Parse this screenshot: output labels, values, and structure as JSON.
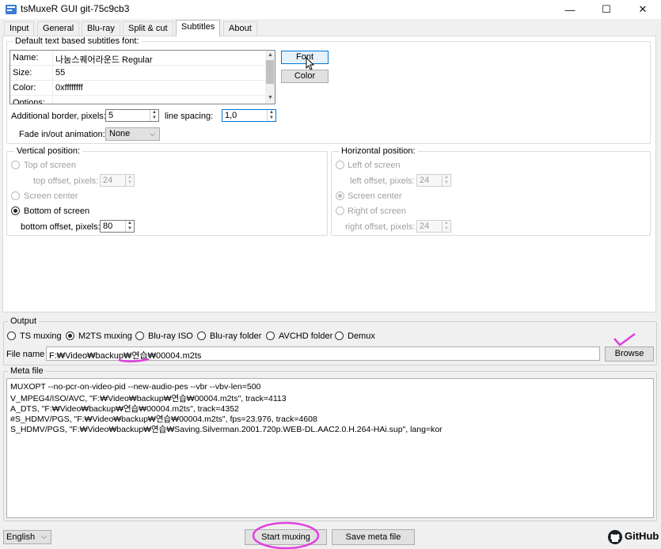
{
  "window": {
    "title": "tsMuxeR GUI git-75c9cb3",
    "minimize_glyph": "—",
    "maximize_glyph": "☐",
    "close_glyph": "✕"
  },
  "tabs": [
    {
      "label": "Input",
      "active": false
    },
    {
      "label": "General",
      "active": false
    },
    {
      "label": "Blu-ray",
      "active": false
    },
    {
      "label": "Split & cut",
      "active": false
    },
    {
      "label": "Subtitles",
      "active": true
    },
    {
      "label": "About",
      "active": false
    }
  ],
  "subtitles": {
    "font_group_legend": "Default text based subtitles font:",
    "properties": [
      {
        "name": "Name:",
        "value": "나눔스퀘어라운드 Regular"
      },
      {
        "name": "Size:",
        "value": "55"
      },
      {
        "name": "Color:",
        "value": "0xffffffff"
      },
      {
        "name": "Options:",
        "value": ""
      }
    ],
    "font_button": "Font",
    "color_button": "Color",
    "border_label": "Additional border, pixels:",
    "border_value": "5",
    "line_spacing_label": "line spacing:",
    "line_spacing_value": "1,0",
    "fade_label": "Fade in/out animation:",
    "fade_value": "None",
    "vertical": {
      "legend": "Vertical position:",
      "top_label": "Top of screen",
      "top_offset_label": "top offset, pixels:",
      "top_offset_value": "24",
      "center_label": "Screen center",
      "bottom_label": "Bottom of screen",
      "bottom_offset_label": "bottom offset, pixels:",
      "bottom_offset_value": "80",
      "selected": "bottom"
    },
    "horizontal": {
      "legend": "Horizontal position:",
      "left_label": "Left of screen",
      "left_offset_label": "left offset, pixels:",
      "left_offset_value": "24",
      "center_label": "Screen center",
      "right_label": "Right of screen",
      "right_offset_label": "right offset, pixels:",
      "right_offset_value": "24",
      "selected": "center"
    }
  },
  "output": {
    "legend": "Output",
    "options": [
      {
        "label": "TS muxing",
        "checked": false
      },
      {
        "label": "M2TS muxing",
        "checked": true
      },
      {
        "label": "Blu-ray ISO",
        "checked": false
      },
      {
        "label": "Blu-ray folder",
        "checked": false
      },
      {
        "label": "AVCHD folder",
        "checked": false
      },
      {
        "label": "Demux",
        "checked": false
      }
    ],
    "file_name_label": "File name",
    "file_name_value": "F:₩Video₩backup₩연습₩00004.m2ts",
    "browse_button": "Browse"
  },
  "meta": {
    "legend": "Meta file",
    "lines": [
      "MUXOPT --no-pcr-on-video-pid --new-audio-pes --vbr --vbv-len=500",
      "V_MPEG4/ISO/AVC, \"F:₩Video₩backup₩연습₩00004.m2ts\", track=4113",
      "A_DTS, \"F:₩Video₩backup₩연습₩00004.m2ts\", track=4352",
      "#S_HDMV/PGS, \"F:₩Video₩backup₩연습₩00004.m2ts\", fps=23.976, track=4608",
      "S_HDMV/PGS, \"F:₩Video₩backup₩연습₩Saving.Silverman.2001.720p.WEB-DL.AAC2.0.H.264-HAi.sup\", lang=kor"
    ]
  },
  "bottom": {
    "language": "English",
    "start_button": "Start muxing",
    "save_button": "Save meta file",
    "github_label": "GitHub"
  },
  "colors": {
    "annotation": "#e040e0",
    "focus_button": "#e5f1fb",
    "focus_border": "#0078d7"
  }
}
